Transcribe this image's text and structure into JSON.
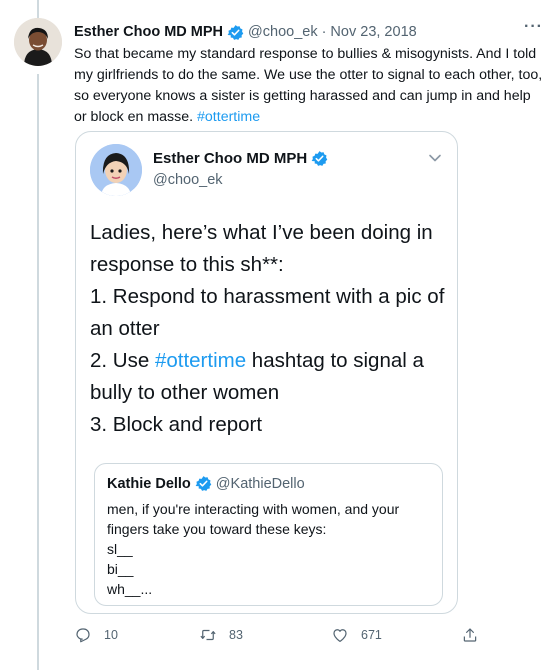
{
  "tweet": {
    "author_name": "Esther Choo MD MPH",
    "handle": "@choo_ek",
    "date": "· Nov 23, 2018",
    "more": "···",
    "text_main": "So that became my standard response to bullies & misogynists. And I told my girlfriends to do the same. We use the otter to signal to each other, too, so everyone knows a sister is getting harassed and can jump in and help or block en masse.",
    "hashtag": "#ottertime"
  },
  "quoted": {
    "author_name": "Esther Choo MD MPH",
    "handle": "@choo_ek",
    "lines": {
      "l1": "Ladies, here’s what I’ve been doing in",
      "l2": "response to this sh**:",
      "l3": "1. Respond to harassment with a pic of",
      "l4": "an otter",
      "l5_pre": "2. Use ",
      "l5_tag": "#ottertime",
      "l5_post": " hashtag to signal a",
      "l6": "bully to other women",
      "l7": "3. Block and report"
    }
  },
  "inner_quote": {
    "author_name": "Kathie Dello",
    "handle": "@KathieDello",
    "text1": "men, if you're interacting with women, and your fingers take you toward these keys:",
    "k1": "sl__",
    "k2": "bi__",
    "k3": "wh__..."
  },
  "actions": {
    "replies": "10",
    "retweets": "83",
    "likes": "671"
  },
  "colors": {
    "accent": "#1d9bf0",
    "muted": "#536471",
    "border": "#cfd9de"
  }
}
